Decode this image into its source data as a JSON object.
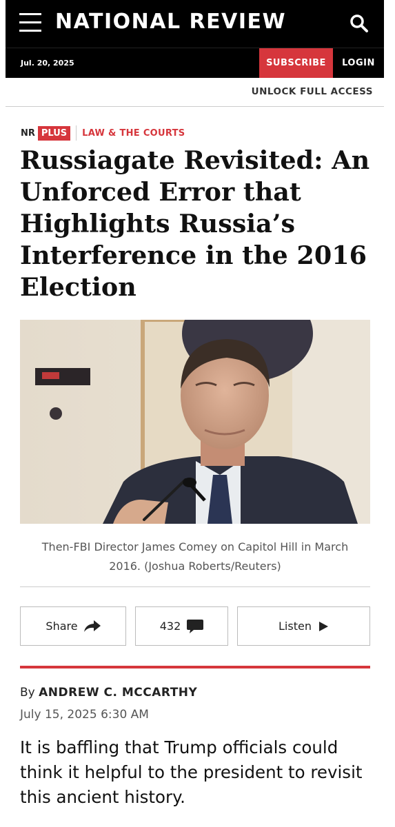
{
  "header": {
    "logo": "NATIONAL REVIEW",
    "date": "Jul. 20, 2025",
    "subscribe_label": "SUBSCRIBE",
    "login_label": "LOGIN",
    "unlock_label": "UNLOCK FULL ACCESS"
  },
  "kicker": {
    "nr": "NR",
    "plus": "PLUS",
    "section": "LAW & THE COURTS"
  },
  "article": {
    "headline": "Russiagate Revisited: An Unforced Error that Highlights Russia’s Interference in the 2016 Election",
    "caption": "Then-FBI Director James Comey on Capitol Hill in March 2016. (Joshua Roberts/Reuters)",
    "byline_prefix": "By",
    "author": "ANDREW C. MCCARTHY",
    "date": "July 15, 2025 6:30 AM",
    "dek": "It is baffling that Trump officials could think it helpful to the president to revisit this ancient history."
  },
  "actions": {
    "share_label": "Share",
    "comments_count": "432",
    "listen_label": "Listen"
  },
  "colors": {
    "brand_red": "#d6363c",
    "header_bg": "#000000"
  },
  "icons": [
    "menu-icon",
    "search-icon",
    "share-arrow-icon",
    "comment-icon",
    "play-icon"
  ]
}
